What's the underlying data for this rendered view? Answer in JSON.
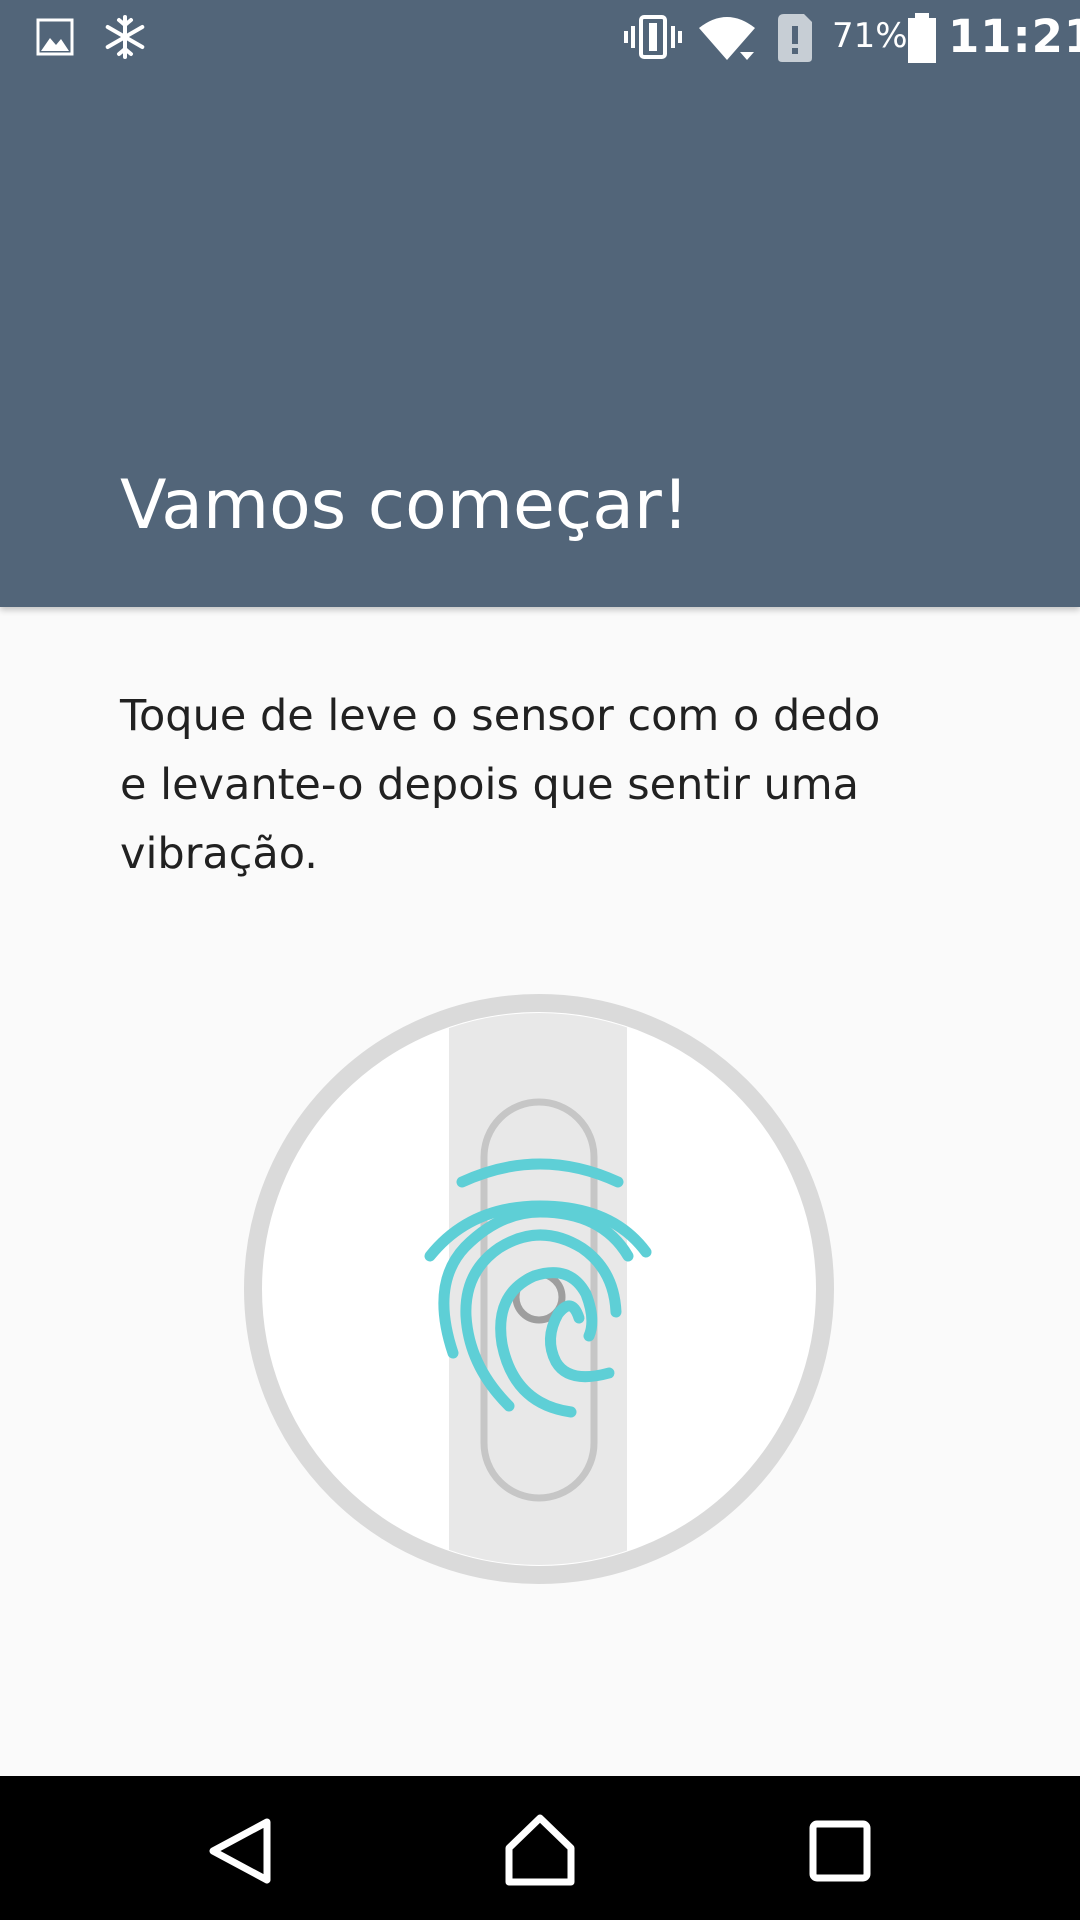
{
  "status_bar": {
    "left_icons": [
      "image-icon",
      "snowflake-icon"
    ],
    "right_icons": [
      "vibrate-icon",
      "wifi-icon",
      "sim-alert-icon",
      "battery-icon"
    ],
    "battery_percent": "71%",
    "battery_level": 0.71,
    "time": "11:21"
  },
  "header": {
    "title": "Vamos começar!",
    "background_color": "#526579"
  },
  "content": {
    "instructions": "Toque de leve o sensor com o dedo e levante-o depois que sentir uma vibração.",
    "illustration_icon": "fingerprint-sensor-icon",
    "accent_color": "#5ecfd6"
  },
  "nav_bar": {
    "buttons": [
      "back-icon",
      "home-icon",
      "recents-icon"
    ]
  }
}
